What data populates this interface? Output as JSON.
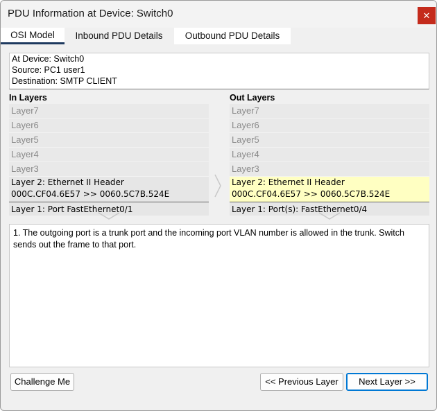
{
  "window": {
    "title": "PDU Information at Device: Switch0",
    "close_glyph": "✕"
  },
  "tabs": [
    {
      "label": "OSI Model",
      "selected": true
    },
    {
      "label": "Inbound PDU Details",
      "selected": false
    },
    {
      "label": "Outbound PDU Details",
      "selected": false
    }
  ],
  "info": {
    "device": "At Device: Switch0",
    "source": "Source: PC1 user1",
    "destination": "Destination: SMTP CLIENT"
  },
  "in_layers": {
    "heading": "In Layers",
    "upper": [
      "Layer7",
      "Layer6",
      "Layer5",
      "Layer4",
      "Layer3"
    ],
    "layer2_title": "Layer 2: Ethernet II Header",
    "layer2_detail": "000C.CF04.6E57 >> 0060.5C7B.524E",
    "layer1": "Layer 1: Port FastEthernet0/1"
  },
  "out_layers": {
    "heading": "Out Layers",
    "upper": [
      "Layer7",
      "Layer6",
      "Layer5",
      "Layer4",
      "Layer3"
    ],
    "layer2_title": "Layer 2: Ethernet II Header",
    "layer2_detail": "000C.CF04.6E57 >> 0060.5C7B.524E",
    "layer1": "Layer 1: Port(s): FastEthernet0/4"
  },
  "description": "1. The outgoing port is a trunk port and the incoming port VLAN number is allowed in the trunk. Switch sends out the frame to that port.",
  "buttons": {
    "challenge": "Challenge Me",
    "previous": "<< Previous Layer",
    "next": "Next Layer >>"
  },
  "colors": {
    "highlight_layer": "#ffffc2",
    "close_button": "#c42b1c",
    "tab_underline": "#1e3a5f",
    "focus_border": "#0078d4"
  },
  "icons": [
    "close-icon",
    "right-arrow-icon",
    "down-arrow-icon"
  ]
}
